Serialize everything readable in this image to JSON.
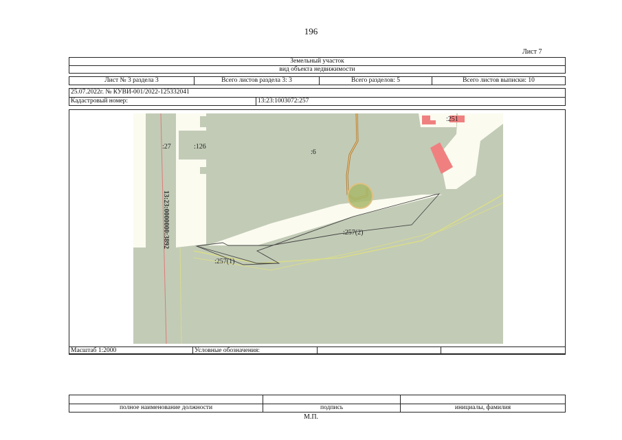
{
  "page_number": "196",
  "sheet_label": "Лист 7",
  "header": {
    "title": "Земельный участок",
    "subtitle": "вид объекта недвижимости",
    "sheet_info": "Лист № 3 раздела 3",
    "section_sheets": "Всего листов раздела 3: 3",
    "sections_total": "Всего разделов: 5",
    "extract_sheets": "Всего листов выписки: 10",
    "doc_ref": "25.07.2022г. № КУВИ-001/2022-125332041",
    "cadastral_label": "Кадастровый номер:",
    "cadastral_number": "13:23:1003072:257"
  },
  "map": {
    "labels": {
      "parcel_27": ":27",
      "parcel_126": ":126",
      "parcel_6": ":6",
      "parcel_251": ":251",
      "parcel_257_2": ":257(2)",
      "parcel_257_1": ":257(1)",
      "road_number": "13:23:0000000:3892"
    },
    "colors": {
      "land": "#c2cbb6",
      "gap": "#fbfbf0",
      "building": "#f08080",
      "road_line": "#e07a7a",
      "boundary": "#d9dc8a",
      "pipe": "#b07830",
      "circle": "#a8b86a"
    }
  },
  "legend": {
    "scale": "Масштаб 1:2000",
    "legend_label": "Условные обозначения:",
    "cell3": "",
    "cell4": ""
  },
  "signature": {
    "position_caption": "полное наименование должности",
    "signature_caption": "подпись",
    "name_caption": "инициалы, фамилия"
  },
  "stamp": "М.П."
}
